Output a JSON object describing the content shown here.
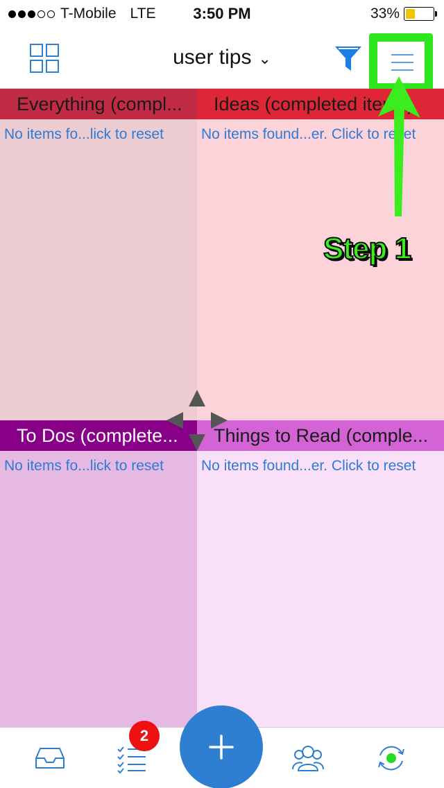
{
  "status_bar": {
    "signal_dots_filled": 3,
    "signal_dots_total": 5,
    "carrier": "T-Mobile",
    "network": "LTE",
    "time": "3:50 PM",
    "battery_percent_label": "33%",
    "battery_level": 0.33
  },
  "nav": {
    "title": "user tips",
    "title_chevron": "⌄",
    "left_icon": "grid-view-icon",
    "filter_icon": "filter-icon",
    "menu_icon": "hamburger-menu-icon"
  },
  "quadrants": [
    {
      "title": "Everything (compl...",
      "message": "No items fo...lick to reset",
      "header_color": "#c22b44",
      "body_color": "#eccbd1"
    },
    {
      "title": "Ideas (completed items)",
      "message": "No items found...er. Click to reset",
      "header_color": "#de2637",
      "body_color": "#fbd3d9"
    },
    {
      "title": "To Dos (complete...",
      "message": "No items fo...lick to reset",
      "header_color": "#880088",
      "body_color": "#e6b9e3"
    },
    {
      "title": "Things to Read (comple...",
      "message": "No items found...er. Click to reset",
      "header_color": "#d464d5",
      "body_color": "#f9dff8"
    }
  ],
  "annotation": {
    "label": "Step 1",
    "color": "#3bec1e"
  },
  "tab_bar": {
    "tasks_badge": "2",
    "icons": [
      "inbox-icon",
      "task-list-icon",
      "add-icon",
      "people-icon",
      "sync-icon"
    ]
  },
  "colors": {
    "accent_blue": "#2e7fd2",
    "badge_red": "#ee1111",
    "highlight_green": "#2ee61e"
  }
}
